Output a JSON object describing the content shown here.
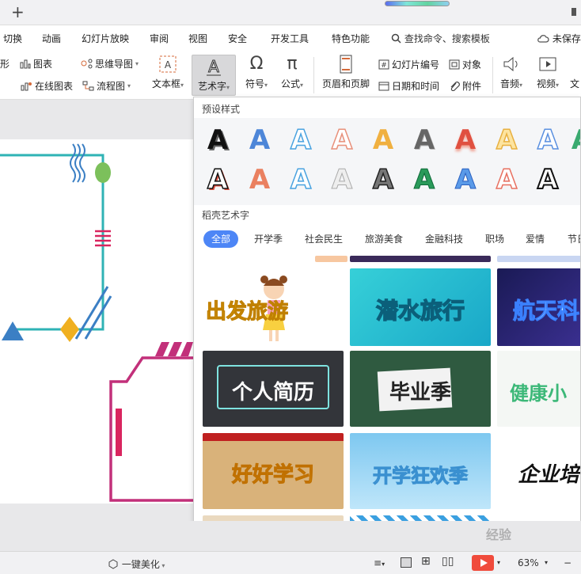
{
  "topbar": {
    "new_tab_symbol": "+"
  },
  "menu": {
    "items": [
      "切换",
      "动画",
      "幻灯片放映",
      "审阅",
      "视图",
      "安全",
      "开发工具",
      "特色功能"
    ],
    "search": "查找命令、搜索模板",
    "unsaved": "未保存"
  },
  "ribbon": {
    "shape_partial": "形",
    "chart": "图表",
    "mindmap": "思维导图",
    "online_chart": "在线图表",
    "flowchart": "流程图",
    "textbox": "文本框",
    "wordart": "艺术字",
    "symbol": "符号",
    "formula": "公式",
    "header_footer": "页眉和页脚",
    "slide_number": "幻灯片编号",
    "object": "对象",
    "datetime": "日期和时间",
    "attachment": "附件",
    "audio": "音频",
    "video": "视频",
    "text_partial": "文"
  },
  "panel": {
    "preset_title": "预设样式",
    "preset_letter": "A",
    "wps_title": "稻壳艺术字",
    "tabs": [
      "全部",
      "开学季",
      "社会民生",
      "旅游美食",
      "金融科技",
      "职场",
      "爱情",
      "节日"
    ],
    "thumbnails": [
      "出发旅游",
      "潜水旅行",
      "航天科",
      "个人简历",
      "毕业季",
      "健康小",
      "好好学习",
      "开学狂欢季",
      "企业培"
    ]
  },
  "status": {
    "beautify": "一键美化",
    "zoom": "63%",
    "zoom_minus": "−",
    "watermark": "经验"
  },
  "colors": {
    "accent": "#4d86f6",
    "play": "#f04b3c"
  }
}
